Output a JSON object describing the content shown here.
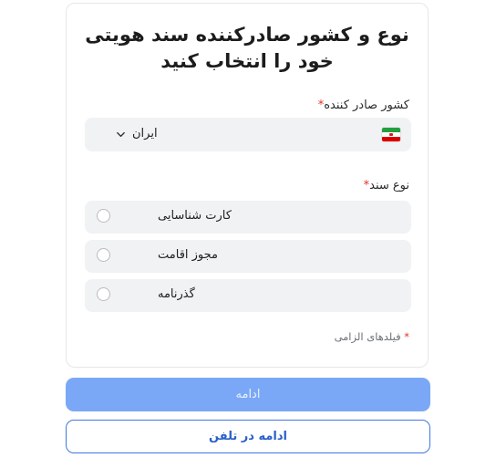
{
  "form": {
    "title": "نوع و کشور صادرکننده سند هویتی خود را انتخاب کنید",
    "country_label": "کشور صادر کننده",
    "country_value": "ایران",
    "country_flag_icon": "iran-flag-icon",
    "doc_type_label": "نوع سند",
    "required_mark": "*",
    "options": [
      {
        "label": "کارت شناسایی"
      },
      {
        "label": "مجوز اقامت"
      },
      {
        "label": "گذرنامه"
      }
    ],
    "required_note": "فیلدهای الزامی"
  },
  "actions": {
    "continue_label": "ادامه",
    "continue_phone_label": "ادامه در تلفن"
  },
  "colors": {
    "primary_disabled": "#7ba8f6",
    "primary_outline": "#3f78df",
    "required": "#e0312f",
    "field_bg": "#f1f2f4"
  }
}
